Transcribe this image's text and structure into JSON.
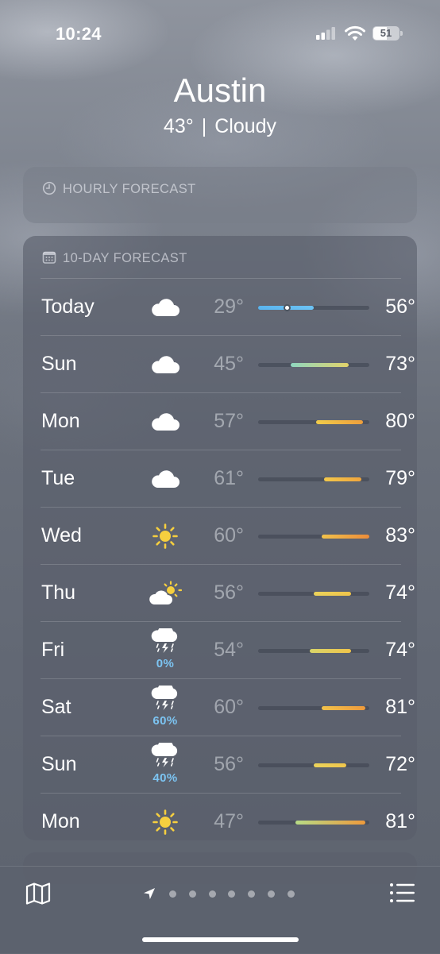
{
  "status_bar": {
    "time": "10:24",
    "battery": "51"
  },
  "header": {
    "city": "Austin",
    "temperature": "43°",
    "separator": "|",
    "condition": "Cloudy"
  },
  "hourly_card": {
    "title": "HOURLY FORECAST",
    "icon": "clock-icon"
  },
  "ten_day_card": {
    "title": "10-DAY FORECAST",
    "icon": "calendar-icon",
    "range_min": 29,
    "range_max": 83,
    "current_temp": 43,
    "rows": [
      {
        "day": "Today",
        "icon": "cloud-icon",
        "precip": "",
        "low": "29°",
        "high": "56°",
        "low_val": 29,
        "high_val": 56,
        "color_from": "#5ab4ee",
        "color_to": "#6cc3f5",
        "show_current": true
      },
      {
        "day": "Sun",
        "icon": "cloud-icon",
        "precip": "",
        "low": "45°",
        "high": "73°",
        "low_val": 45,
        "high_val": 73,
        "color_from": "#8fd7c0",
        "color_to": "#e3d36a",
        "show_current": false
      },
      {
        "day": "Mon",
        "icon": "cloud-icon",
        "precip": "",
        "low": "57°",
        "high": "80°",
        "low_val": 57,
        "high_val": 80,
        "color_from": "#f1cc4a",
        "color_to": "#ee9e3c",
        "show_current": false
      },
      {
        "day": "Tue",
        "icon": "cloud-icon",
        "precip": "",
        "low": "61°",
        "high": "79°",
        "low_val": 61,
        "high_val": 79,
        "color_from": "#f2c84b",
        "color_to": "#efa53d",
        "show_current": false
      },
      {
        "day": "Wed",
        "icon": "sun-icon",
        "precip": "",
        "low": "60°",
        "high": "83°",
        "low_val": 60,
        "high_val": 83,
        "color_from": "#f1c24b",
        "color_to": "#ec8c3a",
        "show_current": false
      },
      {
        "day": "Thu",
        "icon": "partly-sunny-icon",
        "precip": "",
        "low": "56°",
        "high": "74°",
        "low_val": 56,
        "high_val": 74,
        "color_from": "#ebd35b",
        "color_to": "#f0c44a",
        "show_current": false
      },
      {
        "day": "Fri",
        "icon": "thunderstorm-icon",
        "precip": "0%",
        "low": "54°",
        "high": "74°",
        "low_val": 54,
        "high_val": 74,
        "color_from": "#d9d569",
        "color_to": "#f0c44a",
        "show_current": false
      },
      {
        "day": "Sat",
        "icon": "thunderstorm-icon",
        "precip": "60%",
        "low": "60°",
        "high": "81°",
        "low_val": 60,
        "high_val": 81,
        "color_from": "#f1c24b",
        "color_to": "#ee9a3c",
        "show_current": false
      },
      {
        "day": "Sun",
        "icon": "thunderstorm-icon",
        "precip": "40%",
        "low": "56°",
        "high": "72°",
        "low_val": 56,
        "high_val": 72,
        "color_from": "#ebd35b",
        "color_to": "#f0c64c",
        "show_current": false
      },
      {
        "day": "Mon",
        "icon": "sun-icon",
        "precip": "",
        "low": "47°",
        "high": "81°",
        "low_val": 47,
        "high_val": 81,
        "color_from": "#b7db86",
        "color_to": "#ee9a3c",
        "show_current": false
      }
    ]
  },
  "bottom_bar": {
    "page_count": 7,
    "current_page": 0
  }
}
